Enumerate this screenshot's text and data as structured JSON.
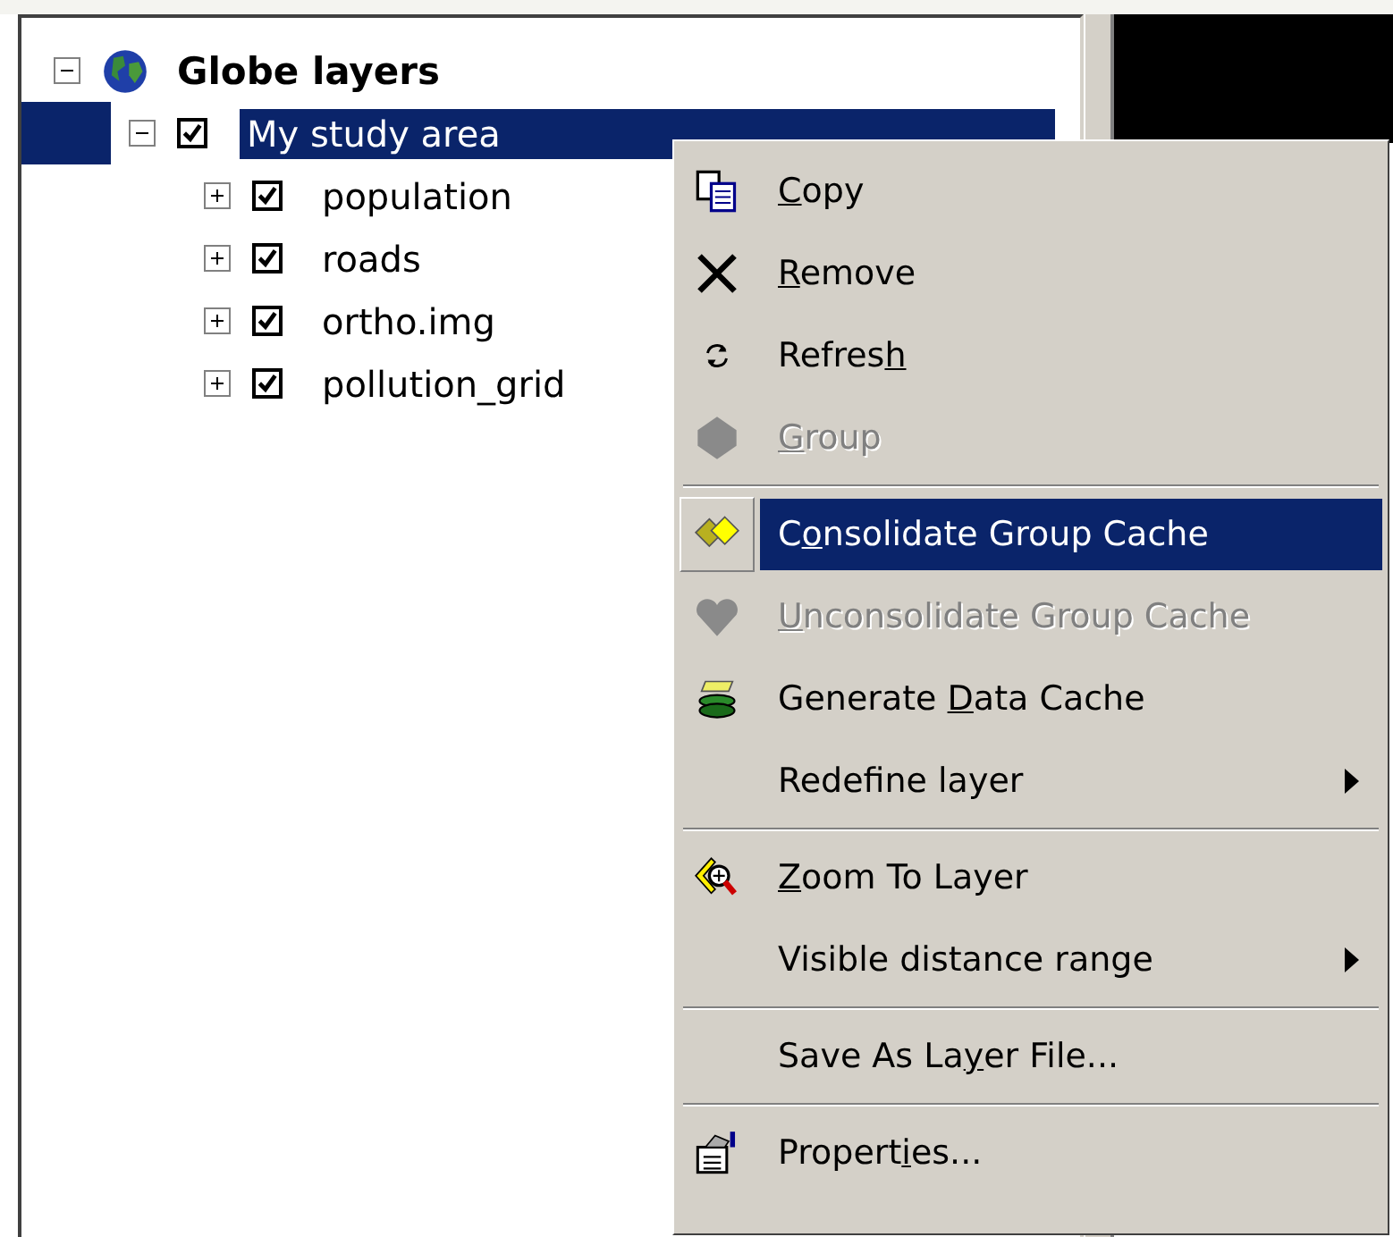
{
  "tree": [
    {
      "label": "Globe layers",
      "expanded": true,
      "selected": false,
      "children": [
        {
          "label": "My study area",
          "expanded": true,
          "checked": true,
          "selected": true,
          "children": [
            {
              "label": "population",
              "expanded": false,
              "checked": true,
              "selected": false
            },
            {
              "label": "roads",
              "expanded": false,
              "checked": true,
              "selected": false
            },
            {
              "label": "ortho.img",
              "expanded": false,
              "checked": true,
              "selected": false
            },
            {
              "label": "pollution_grid",
              "expanded": false,
              "checked": true,
              "selected": false
            }
          ]
        }
      ]
    }
  ],
  "context_menu": {
    "items": [
      {
        "kind": "item",
        "label": [
          {
            "text": "C",
            "underline": true
          },
          {
            "text": "opy",
            "underline": false
          }
        ],
        "disabled": false,
        "selected": false,
        "submenu": false
      },
      {
        "kind": "item",
        "label": [
          {
            "text": "R",
            "underline": true
          },
          {
            "text": "emove",
            "underline": false
          }
        ],
        "disabled": false,
        "selected": false,
        "submenu": false
      },
      {
        "kind": "item",
        "label": [
          {
            "text": "Refres",
            "underline": false
          },
          {
            "text": "h",
            "underline": true
          }
        ],
        "disabled": false,
        "selected": false,
        "submenu": false
      },
      {
        "kind": "item",
        "label": [
          {
            "text": "G",
            "underline": true
          },
          {
            "text": "roup",
            "underline": false
          }
        ],
        "disabled": true,
        "selected": false,
        "submenu": false
      },
      {
        "kind": "separator"
      },
      {
        "kind": "item",
        "label": [
          {
            "text": "C",
            "underline": false
          },
          {
            "text": "o",
            "underline": true
          },
          {
            "text": "nsolidate Group Cache",
            "underline": false
          }
        ],
        "disabled": false,
        "selected": true,
        "submenu": false
      },
      {
        "kind": "item",
        "label": [
          {
            "text": "U",
            "underline": true
          },
          {
            "text": "nconsolidate Group Cache",
            "underline": false
          }
        ],
        "disabled": true,
        "selected": false,
        "submenu": false
      },
      {
        "kind": "item",
        "label": [
          {
            "text": "Generate ",
            "underline": false
          },
          {
            "text": "D",
            "underline": true
          },
          {
            "text": "ata Cache",
            "underline": false
          }
        ],
        "disabled": false,
        "selected": false,
        "submenu": false
      },
      {
        "kind": "item",
        "label": [
          {
            "text": "Redefine layer",
            "underline": false
          }
        ],
        "disabled": false,
        "selected": false,
        "submenu": true
      },
      {
        "kind": "separator"
      },
      {
        "kind": "item",
        "label": [
          {
            "text": "Z",
            "underline": true
          },
          {
            "text": "oom To Layer",
            "underline": false
          }
        ],
        "disabled": false,
        "selected": false,
        "submenu": false
      },
      {
        "kind": "item",
        "label": [
          {
            "text": "Visible distance range",
            "underline": false
          }
        ],
        "disabled": false,
        "selected": false,
        "submenu": true
      },
      {
        "kind": "separator"
      },
      {
        "kind": "item",
        "label": [
          {
            "text": "Save As La",
            "underline": false
          },
          {
            "text": "y",
            "underline": true
          },
          {
            "text": "er File...",
            "underline": false
          }
        ],
        "disabled": false,
        "selected": false,
        "submenu": false
      },
      {
        "kind": "separator"
      },
      {
        "kind": "item",
        "label": [
          {
            "text": "Propert",
            "underline": false
          },
          {
            "text": "i",
            "underline": true
          },
          {
            "text": "es...",
            "underline": false
          }
        ],
        "disabled": false,
        "selected": false,
        "submenu": false
      }
    ]
  }
}
